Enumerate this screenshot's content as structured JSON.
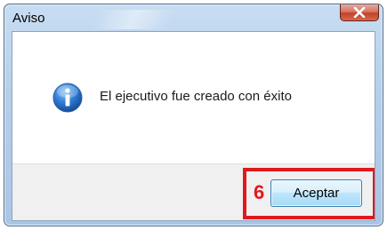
{
  "window": {
    "title": "Aviso",
    "close_icon": "close-x-icon"
  },
  "message": {
    "icon": "info-icon",
    "text": "El ejecutivo fue creado con éxito"
  },
  "annotation": {
    "step_number": "6",
    "highlight_color": "#e0191c"
  },
  "footer": {
    "ok_label": "Aceptar"
  },
  "colors": {
    "close_button": "#c3412a",
    "button_border": "#3c7fb1",
    "info_icon": "#1d5fb4"
  }
}
